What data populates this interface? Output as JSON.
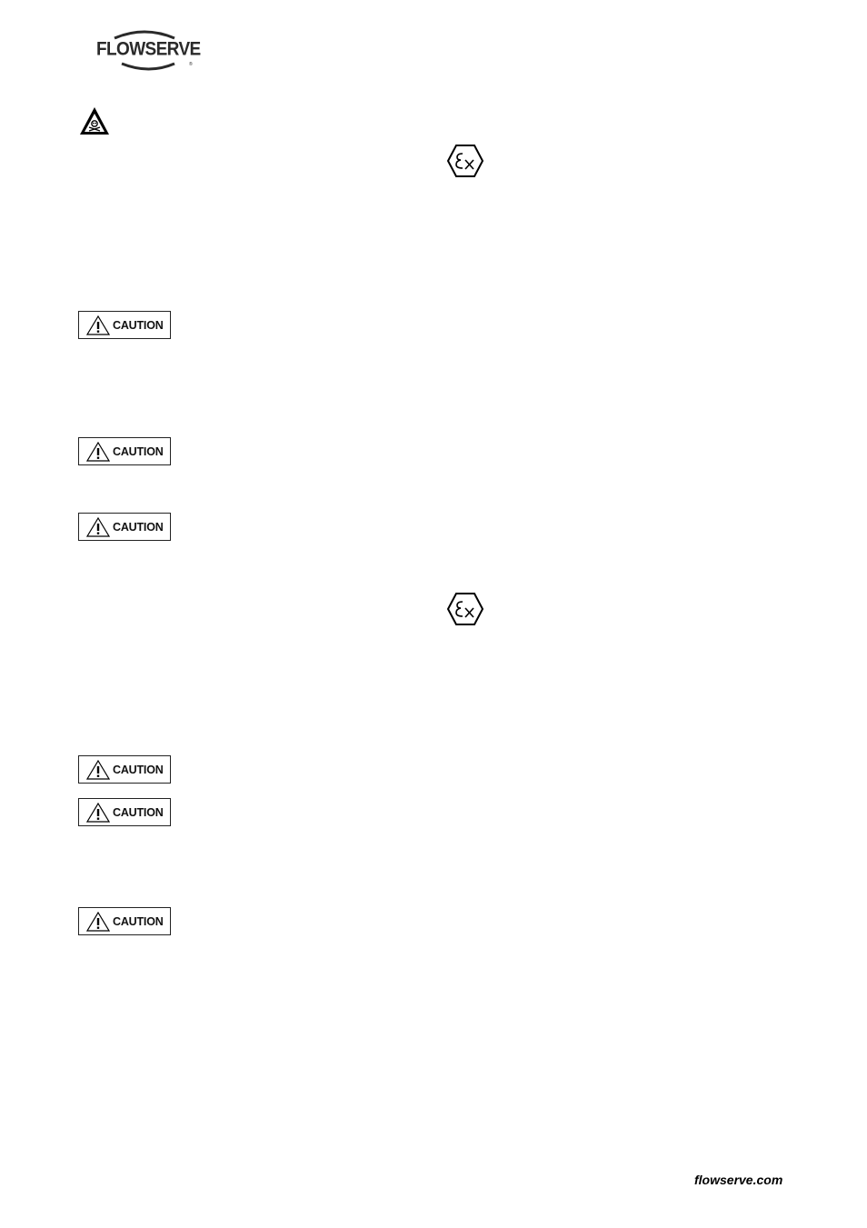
{
  "header": {
    "brand_logo_text": "FLOWSERVE"
  },
  "icons": {
    "toxic_hazard": "toxic-hazard-icon",
    "explosion_proof": "ex-atex-icon",
    "caution": "caution-warning-icon"
  },
  "caution_labels": [
    "CAUTION",
    "CAUTION",
    "CAUTION",
    "CAUTION",
    "CAUTION",
    "CAUTION"
  ],
  "footer": {
    "website": "flowserve.com"
  }
}
